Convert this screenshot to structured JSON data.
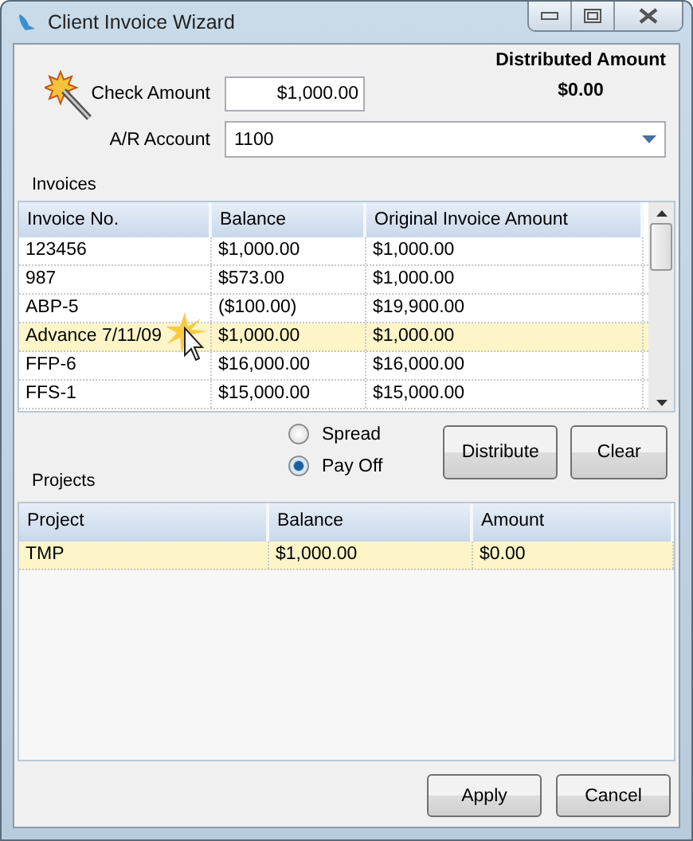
{
  "window": {
    "title": "Client Invoice Wizard"
  },
  "check_amount": {
    "label": "Check Amount",
    "value": "$1,000.00"
  },
  "ar_account": {
    "label": "A/R Account",
    "value": "1100"
  },
  "distributed": {
    "label": "Distributed Amount",
    "value": "$0.00"
  },
  "invoices": {
    "title": "Invoices",
    "columns": [
      "Invoice No.",
      "Balance",
      "Original Invoice Amount"
    ],
    "rows": [
      {
        "cells": [
          "123456",
          "$1,000.00",
          "$1,000.00"
        ],
        "selected": false
      },
      {
        "cells": [
          "987",
          "$573.00",
          "$1,000.00"
        ],
        "selected": false
      },
      {
        "cells": [
          "ABP-5",
          "($100.00)",
          "$19,900.00"
        ],
        "selected": false
      },
      {
        "cells": [
          "Advance 7/11/09",
          "$1,000.00",
          "$1,000.00"
        ],
        "selected": true
      },
      {
        "cells": [
          "FFP-6",
          "$16,000.00",
          "$16,000.00"
        ],
        "selected": false
      },
      {
        "cells": [
          "FFS-1",
          "$15,000.00",
          "$15,000.00"
        ],
        "selected": false
      }
    ]
  },
  "mode": [
    {
      "label": "Spread",
      "selected": false
    },
    {
      "label": "Pay Off",
      "selected": true
    }
  ],
  "actions": [
    "Distribute",
    "Clear"
  ],
  "projects": {
    "title": "Projects",
    "columns": [
      "Project",
      "Balance",
      "Amount"
    ],
    "rows": [
      {
        "cells": [
          "TMP",
          "$1,000.00",
          "$0.00"
        ],
        "selected": true
      }
    ]
  },
  "buttons": [
    "Apply",
    "Cancel"
  ]
}
